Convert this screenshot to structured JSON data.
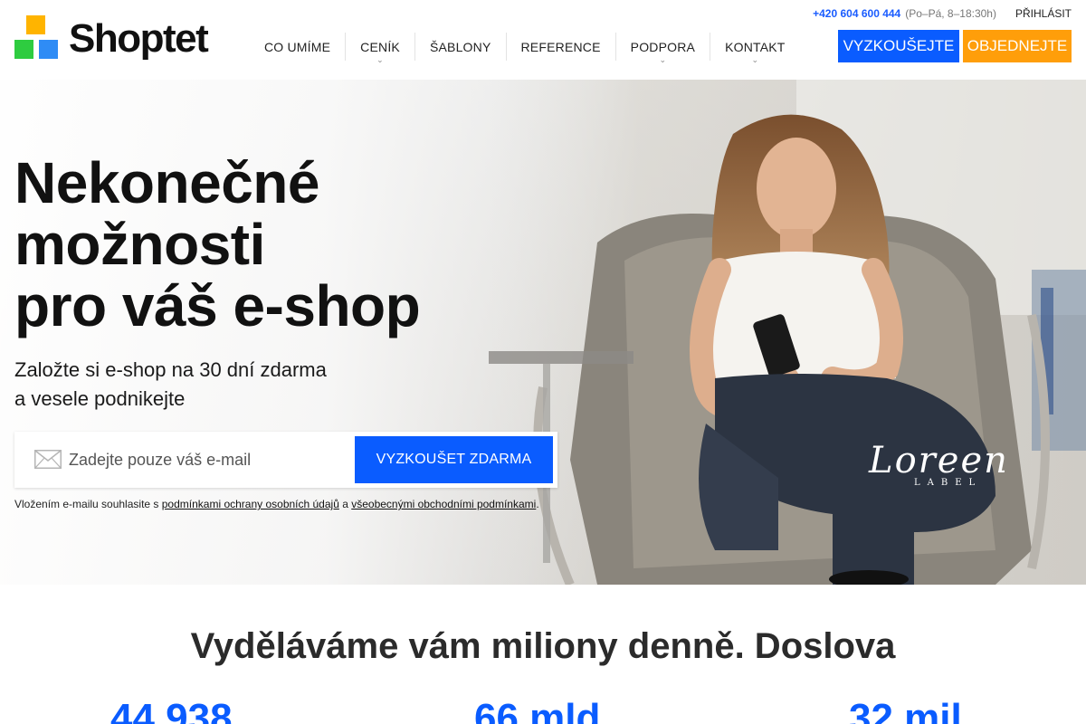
{
  "brand": {
    "name": "Shoptet"
  },
  "topbar": {
    "phone": "+420 604 600 444",
    "hours": "(Po–Pá, 8–18:30h)",
    "login_label": "PŘIHLÁSIT"
  },
  "nav": {
    "items": [
      {
        "label": "CO UMÍME",
        "dropdown": false
      },
      {
        "label": "CENÍK",
        "dropdown": true
      },
      {
        "label": "ŠABLONY",
        "dropdown": false
      },
      {
        "label": "REFERENCE",
        "dropdown": false
      },
      {
        "label": "PODPORA",
        "dropdown": true
      },
      {
        "label": "KONTAKT",
        "dropdown": true
      }
    ],
    "try_label": "VYZKOUŠEJTE",
    "order_label": "OBJEDNEJTE"
  },
  "hero": {
    "title_line1": "Nekonečné",
    "title_line2": "možnosti",
    "title_line3": "pro váš e-shop",
    "subtitle_line1": "Založte si e-shop na 30 dní zdarma",
    "subtitle_line2": "a vesele podnikejte",
    "email_placeholder": "Zadejte pouze váš e-mail",
    "submit_label": "VYZKOUŠET ZDARMA",
    "consent_prefix": "Vložením e-mailu souhlasite s ",
    "consent_link1": "podmínkami ochrany osobních údajů",
    "consent_mid": " a ",
    "consent_link2": "všeobecnými obchodními podmínkami",
    "consent_suffix": ".",
    "brand_script": "Loreen",
    "brand_label": "LABEL"
  },
  "stats": {
    "title": "Vyděláváme vám miliony denně. Doslova",
    "values": [
      "44 938",
      "66 mld",
      "32 mil"
    ]
  },
  "colors": {
    "primary": "#0a5cff",
    "accent": "#ff9e0a",
    "logo_yellow": "#ffb400",
    "logo_green": "#2ecc40",
    "logo_blue": "#2f8cf5"
  },
  "icons": [
    "envelope-icon",
    "chevron-down-icon"
  ]
}
